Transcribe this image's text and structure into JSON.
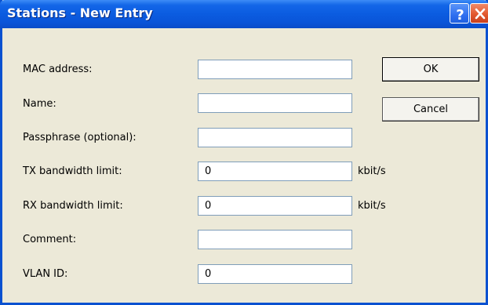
{
  "window": {
    "title": "Stations - New Entry",
    "help_icon": "help-icon",
    "close_icon": "close-icon"
  },
  "form": {
    "fields": [
      {
        "label": "MAC address:",
        "value": "",
        "unit": ""
      },
      {
        "label": "Name:",
        "value": "",
        "unit": ""
      },
      {
        "label": "Passphrase (optional):",
        "value": "",
        "unit": ""
      },
      {
        "label": "TX bandwidth limit:",
        "value": "0",
        "unit": "kbit/s"
      },
      {
        "label": "RX bandwidth limit:",
        "value": "0",
        "unit": "kbit/s"
      },
      {
        "label": "Comment:",
        "value": "",
        "unit": ""
      },
      {
        "label": "VLAN ID:",
        "value": "0",
        "unit": ""
      }
    ]
  },
  "buttons": {
    "ok": "OK",
    "cancel": "Cancel"
  },
  "colors": {
    "titlebar": "#0a54d8",
    "window_bg": "#ece9d8",
    "close_button": "#e2582e"
  }
}
